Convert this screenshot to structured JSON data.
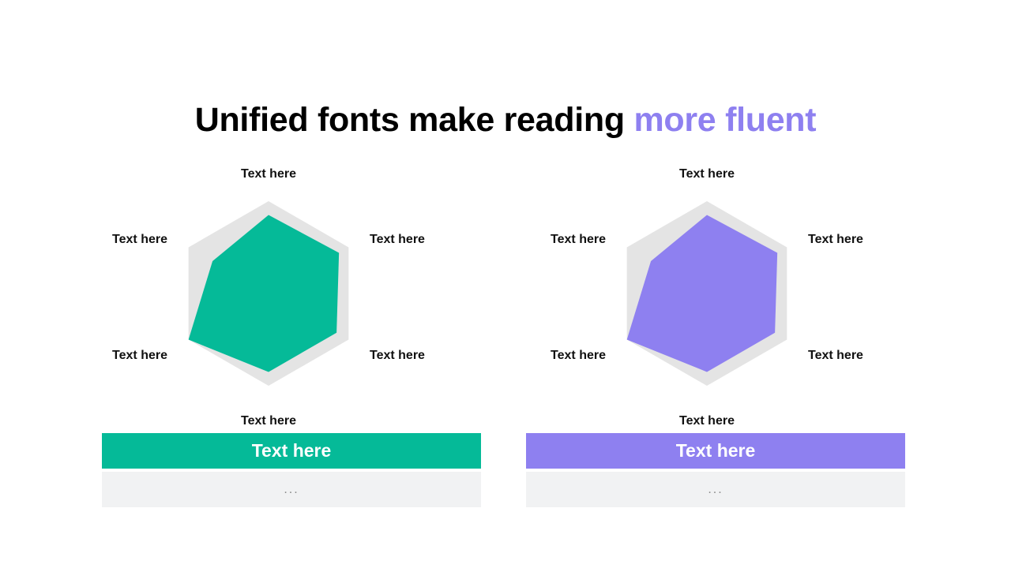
{
  "title": {
    "main": "Unified fonts make reading ",
    "accent": "more fluent"
  },
  "colors": {
    "accent": "#8e80f0",
    "green": "#05ba98",
    "purple": "#8e80f0",
    "reference": "#e4e4e4"
  },
  "chart_data": [
    {
      "type": "radar",
      "axes": [
        "Text here",
        "Text here",
        "Text here",
        "Text here",
        "Text here",
        "Text here"
      ],
      "reference_values": [
        1,
        1,
        1,
        1,
        1,
        1
      ],
      "values": [
        0.85,
        0.88,
        0.85,
        0.85,
        1.0,
        0.7
      ],
      "range": [
        0,
        1
      ],
      "series_color": "#05ba98",
      "reference_color": "#e4e4e4",
      "header": "Text here",
      "body": "..."
    },
    {
      "type": "radar",
      "axes": [
        "Text here",
        "Text here",
        "Text here",
        "Text here",
        "Text here",
        "Text here"
      ],
      "reference_values": [
        1,
        1,
        1,
        1,
        1,
        1
      ],
      "values": [
        0.85,
        0.88,
        0.85,
        0.85,
        1.0,
        0.7
      ],
      "range": [
        0,
        1
      ],
      "series_color": "#8e80f0",
      "reference_color": "#e4e4e4",
      "header": "Text here",
      "body": "..."
    }
  ]
}
